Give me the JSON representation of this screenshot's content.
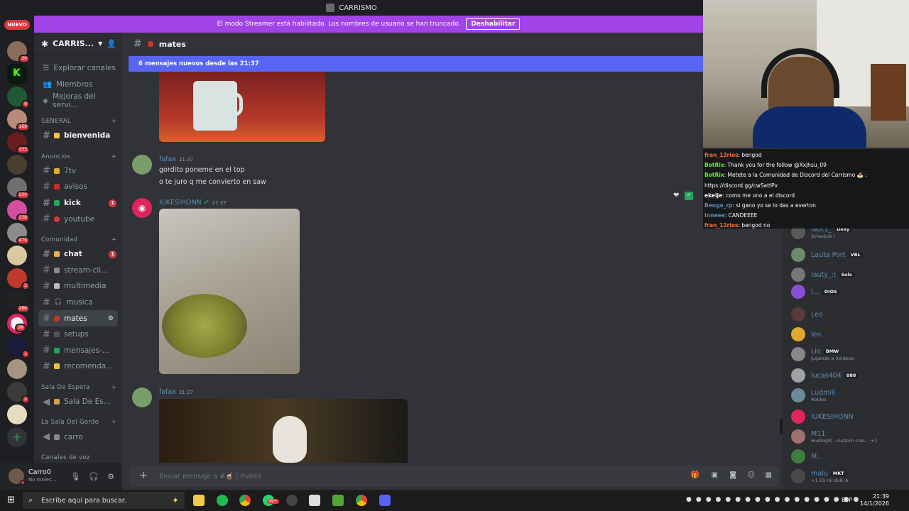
{
  "window": {
    "title": "CARRISMO"
  },
  "servers": {
    "new_badge": "NUEVO",
    "badges": [
      "30",
      "9",
      "169",
      "333",
      "504",
      "228",
      "479",
      "2",
      "2",
      "286",
      "99",
      "1"
    ]
  },
  "streamer_banner": {
    "text": "El modo Streamer está habilitado. Los nombres de usuario se han truncado.",
    "button": "Deshabilitar"
  },
  "sidebar": {
    "server_name": "CARRIS...",
    "nav": [
      "Explorar canales",
      "Miembros",
      "Mejoras del servi..."
    ],
    "categories": {
      "general": "GENERAL",
      "anuncios": "Anuncios",
      "comunidad": "Comunidad",
      "sala_espera": "Sala De Espera",
      "sala_gordo": "La Sala Del Gordo",
      "canales_voz": "Canales de voz"
    },
    "channels": {
      "bienvenida": "bienvenida",
      "7tv": "7tv",
      "avisos": "avisos",
      "kick": "kick",
      "youtube": "youtube",
      "chat": "chat",
      "streamclips": "stream-cli...",
      "multimedia": "multimedia",
      "musica": "musica",
      "mates": "mates",
      "setups": "setups",
      "mensajes": "mensajes-...",
      "recomenda": "recomenda...",
      "sala_de_es": "Sala De Es...",
      "carro": "carro"
    },
    "badges": {
      "kick": "1",
      "chat": "1"
    }
  },
  "user": {
    "name": "Carro0",
    "status": "No moles..."
  },
  "channel": {
    "name": "mates",
    "new_messages": "6 mensajes nuevos desde las 21:37",
    "composer_placeholder": "Enviar mensaje a #🧉 | mates"
  },
  "messages": [
    {
      "author": "fafax",
      "time": "21:37",
      "lines": [
        "gordito poneme en el top",
        "o te juro q me convierto en saw"
      ]
    },
    {
      "author": "IUKESIHONN",
      "time": "21:37"
    },
    {
      "author": "fafax",
      "time": "21:37"
    }
  ],
  "chat_overlay": [
    {
      "user": "fran_12rios",
      "text": ": bengod",
      "color": "#ff6a3d"
    },
    {
      "user": "BotRix",
      "text": ": Thank you for the follow @Xxjhsu_09",
      "color": "#53fc18"
    },
    {
      "user": "BotRix",
      "text": ": Metete a la Comunidad de Discord del Carrismo 🍝 : https://discord.gg/cwSattPv",
      "color": "#53fc18"
    },
    {
      "user": "ekelje",
      "text": ": como me uno a el discord",
      "color": "#ffffff"
    },
    {
      "user": "Bengo_rp",
      "text": ": si gano yo se lo das a everton",
      "color": "#5f8db2"
    },
    {
      "user": "Inneee",
      "text": ": CANDEEEE",
      "color": "#5f8db2"
    },
    {
      "user": "fran_12rios",
      "text": ": bengod no",
      "color": "#ff6a3d"
    }
  ],
  "members": [
    {
      "name": "laut1_",
      "tag": "Dexy",
      "status": "Schedule I"
    },
    {
      "name": "Lauta Port",
      "tag": "VBL",
      "status": ""
    },
    {
      "name": "lauty_:(",
      "tag": "Sols",
      "status": ""
    },
    {
      "name": "l...",
      "tag": "DIOS",
      "status": ""
    },
    {
      "name": "Leo",
      "tag": "",
      "status": ""
    },
    {
      "name": "leo",
      "tag": "",
      "status": ""
    },
    {
      "name": "Lio",
      "tag": "BMW",
      "status": "Jugando a Xvideos"
    },
    {
      "name": "lucas404",
      "tag": "888",
      "status": ""
    },
    {
      "name": "Ludmiii",
      "tag": "",
      "status": "Roblox"
    },
    {
      "name": "IUKESIHONN",
      "tag": "",
      "status": ""
    },
    {
      "name": "M11",
      "tag": "",
      "status": "HudSight - custom cros...  +1"
    },
    {
      "name": "M...",
      "tag": "",
      "status": ""
    },
    {
      "name": "malu",
      "tag": "MKT",
      "status": "+1  ES mi duki A"
    }
  ],
  "taskbar": {
    "search_placeholder": "Escribe aquí para buscar.",
    "lang": "ESP",
    "time": "21:39",
    "date": "14/1/2026",
    "badge": "99+"
  },
  "colors": {
    "blurple": "#5865f2",
    "streamer": "#a044e6",
    "red": "#da373c",
    "green": "#23a55a"
  }
}
